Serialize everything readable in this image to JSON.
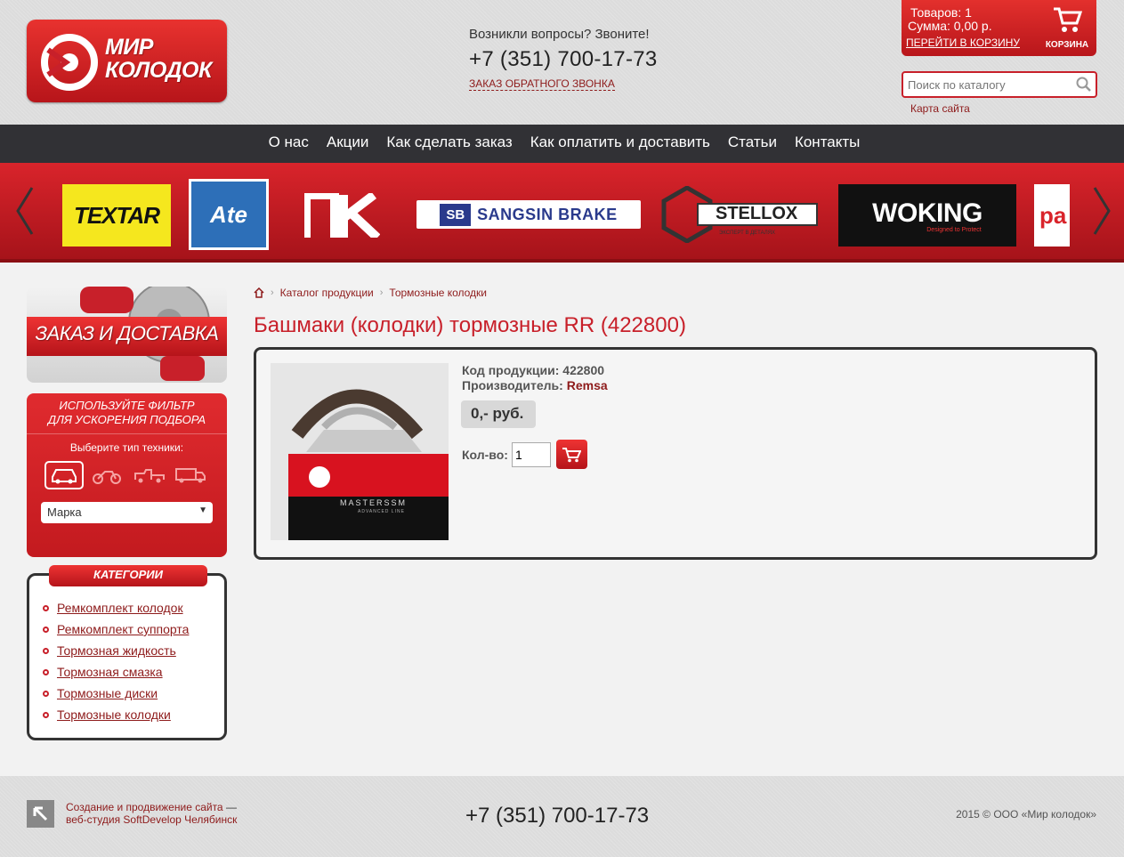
{
  "header": {
    "logo_text": [
      "МИР",
      "КОЛОДОК"
    ],
    "question": "Возникли вопросы? Звоните!",
    "phone": "+7 (351) 700-17-73",
    "callback": "ЗАКАЗ ОБРАТНОГО ЗВОНКА"
  },
  "cart": {
    "items": "Товаров: 1",
    "sum": "Сумма: 0,00 р.",
    "go": "ПЕРЕЙТИ В КОРЗИНУ",
    "label": "КОРЗИНА"
  },
  "search": {
    "placeholder": "Поиск по каталогу",
    "icon": "search-icon"
  },
  "sitemap": "Карта сайта",
  "nav": [
    "О нас",
    "Акции",
    "Как сделать заказ",
    "Как оплатить и доставить",
    "Статьи",
    "Контакты"
  ],
  "brands": {
    "textar": "TEXTAR",
    "ate": "Ate",
    "sb_short": "SB",
    "sb_name": "SANGSIN BRAKE",
    "stellox": "STELLOX",
    "stellox_sub": "ЭКСПЕРТ В ДЕТАЛЯХ",
    "woking": "WOKING",
    "woking_sub": "Designed to Protect",
    "partial": "pa"
  },
  "sidebar": {
    "delivery": "ЗАКАЗ И ДОСТАВКА",
    "filter_title": [
      "ИСПОЛЬЗУЙТЕ ФИЛЬТР",
      "ДЛЯ УСКОРЕНИЯ ПОДБОРА"
    ],
    "filter_sub": "Выберите тип техники:",
    "vehicle_icons": [
      "car-icon",
      "motorcycle-icon",
      "tow-truck-icon",
      "truck-icon"
    ],
    "brand_select": "Марка",
    "categories_title": "КАТЕГОРИИ",
    "categories": [
      "Ремкомплект колодок",
      "Ремкомплект суппорта",
      "Тормозная жидкость",
      "Тормозная смазка",
      "Тормозные диски",
      "Тормозные колодки"
    ]
  },
  "breadcrumbs": [
    "Каталог продукции",
    "Тормозные колодки"
  ],
  "product": {
    "title": "Башмаки (колодки) тормозные RR (422800)",
    "code_label": "Код продукции:",
    "code": "422800",
    "maker_label": "Производитель:",
    "maker": "Remsa",
    "price": "0,- руб.",
    "qty_label": "Кол-во:",
    "qty": "1",
    "box_text": "MASTERSSM",
    "box_sub": "ADVANCED LINE"
  },
  "footer": {
    "link1": "Создание и продвижение сайта",
    "dash": " —",
    "link2": "веб-студия SoftDevelop Челябинск",
    "phone": "+7 (351) 700-17-73",
    "copyright": "2015 © ООО «Мир колодок»"
  },
  "colors": {
    "accent": "#c8202a",
    "nav_bg": "#313135",
    "link": "#8e1b1b"
  }
}
